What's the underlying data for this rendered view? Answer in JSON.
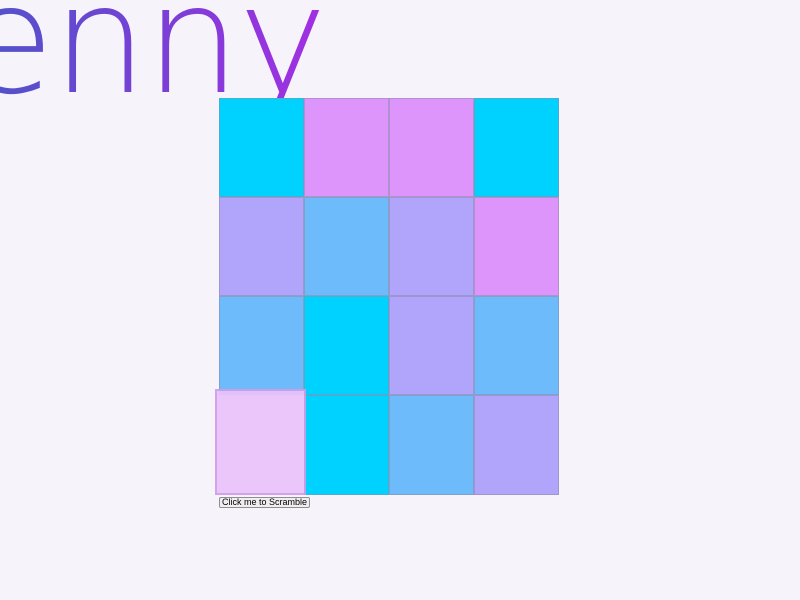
{
  "logo": {
    "text": "enny"
  },
  "palette": {
    "cyan": "#00d2ff",
    "pink": "#dd94fb",
    "lavender": "#b0a4fb",
    "sky": "#6dbbfb",
    "light_pink": "#eac3fb"
  },
  "grid": {
    "rows": 4,
    "cols": 4,
    "tiles": [
      [
        "cyan",
        "pink",
        "pink",
        "cyan"
      ],
      [
        "lavender",
        "sky",
        "lavender",
        "pink"
      ],
      [
        "sky",
        "cyan",
        "lavender",
        "sky"
      ],
      [
        "light_pink",
        "cyan",
        "sky",
        "lavender"
      ]
    ],
    "lifted_tile": [
      3,
      0
    ]
  },
  "controls": {
    "scramble_label": "Click me to Scramble"
  }
}
